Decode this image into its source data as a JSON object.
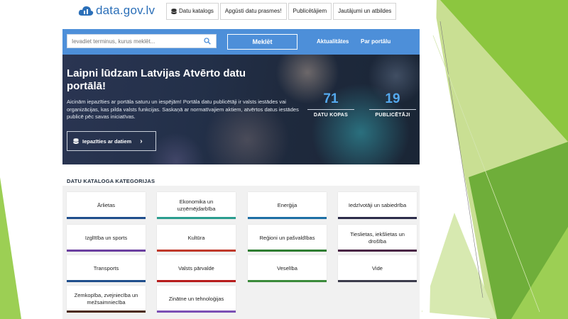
{
  "header": {
    "logo_text": "data.gov.lv",
    "nav": [
      {
        "label": "Datu katalogs"
      },
      {
        "label": "Apgūsti datu prasmes!"
      },
      {
        "label": "Publicētājiem"
      },
      {
        "label": "Jautājumi un atbildes"
      }
    ]
  },
  "search": {
    "placeholder": "Ievadiet terminus, kurus meklēt...",
    "button_label": "Meklēt",
    "links": [
      "Aktualitātes",
      "Par portālu"
    ]
  },
  "hero": {
    "title": "Laipni lūdzam Latvijas Atvērto datu portālā!",
    "description": "Aicinām iepazīties ar portāla saturu un iespējām! Portāla datu publicētāji ir valsts iestādes vai organizācijas, kas pilda valsts funkcijas. Saskaņā ar normatīvajiem aktiem, atvērtos datus iestādes publicē pēc savas iniciatīvas.",
    "explore_button": "Iepazīties ar datiem",
    "stats": [
      {
        "value": "71",
        "label": "DATU KOPAS"
      },
      {
        "value": "19",
        "label": "PUBLICĒTĀJI"
      }
    ]
  },
  "categories": {
    "title": "DATU KATALOGA KATEGORIJAS",
    "items": [
      {
        "label": "Ārlietas",
        "color": "#1f4e8c"
      },
      {
        "label": "Ekonomika un uzņēmējdarbība",
        "color": "#2a9d8f"
      },
      {
        "label": "Enerģija",
        "color": "#1d6fa5"
      },
      {
        "label": "Iedzīvotāji un sabiedrība",
        "color": "#2c2c4a"
      },
      {
        "label": "Izglītība un sports",
        "color": "#6b3fa0"
      },
      {
        "label": "Kultūra",
        "color": "#c0392b"
      },
      {
        "label": "Reģioni un pašvaldības",
        "color": "#2e7d32"
      },
      {
        "label": "Tieslietas, iekšlietas un drošība",
        "color": "#4a2545"
      },
      {
        "label": "Transports",
        "color": "#1f4e8c"
      },
      {
        "label": "Valsts pārvalde",
        "color": "#b71c1c"
      },
      {
        "label": "Veselība",
        "color": "#3a8a3a"
      },
      {
        "label": "Vide",
        "color": "#3c3c4c"
      },
      {
        "label": "Zemkopība, zvejniecība un mežsaimniecība",
        "color": "#4a2a12"
      },
      {
        "label": "Zinātne un tehnoloģijas",
        "color": "#7b4fb5"
      }
    ]
  },
  "decor": {
    "slide_green_light": "#c8dc8c",
    "slide_green": "#8cc63f",
    "slide_green_dark": "#5e9a2c"
  }
}
